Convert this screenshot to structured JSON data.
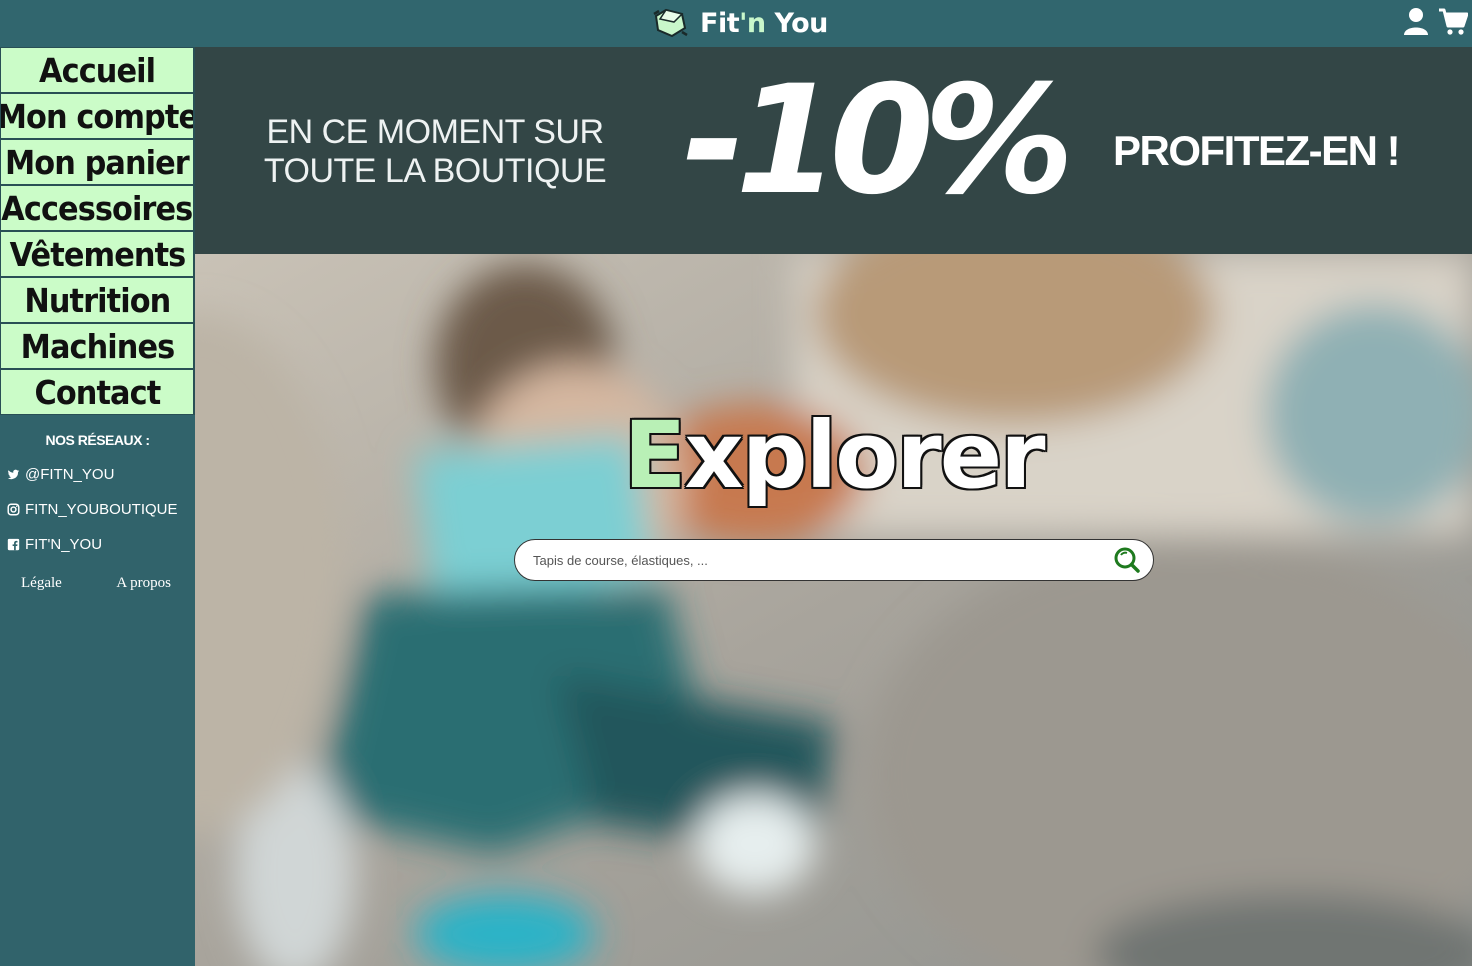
{
  "header": {
    "logo_text_a": "Fit",
    "logo_text_b": "'n",
    "logo_text_c": " You",
    "icons": [
      "user-icon",
      "cart-icon"
    ]
  },
  "sidebar": {
    "items": [
      {
        "label": "Accueil"
      },
      {
        "label": "Mon compte"
      },
      {
        "label": "Mon panier"
      },
      {
        "label": "Accessoires"
      },
      {
        "label": "Vêtements"
      },
      {
        "label": "Nutrition"
      },
      {
        "label": "Machines"
      },
      {
        "label": "Contact"
      }
    ],
    "networks_title": "NOS RÉSEAUX :",
    "socials": [
      {
        "icon": "twitter-icon",
        "label": "@FITN_YOU"
      },
      {
        "icon": "instagram-icon",
        "label": "FITN_YOUBOUTIQUE"
      },
      {
        "icon": "facebook-icon",
        "label": "FIT'N_YOU"
      }
    ],
    "footer": {
      "legal": "Légale",
      "about": "A propos"
    }
  },
  "promo": {
    "line1": "EN CE MOMENT SUR",
    "line2": "TOUTE LA BOUTIQUE",
    "discount": "-10%",
    "cta": "PROFITEZ-EN !"
  },
  "hero": {
    "title_first": "E",
    "title_rest": "xplorer",
    "search_placeholder": "Tapis de course, élastiques, ..."
  },
  "colors": {
    "topbar": "#31666e",
    "sidebar": "#31636b",
    "nav_bg": "#cbfcc8",
    "promo_bg": "#334646",
    "accent_green": "#b9f0b6",
    "search_icon": "#1e7a1e"
  }
}
